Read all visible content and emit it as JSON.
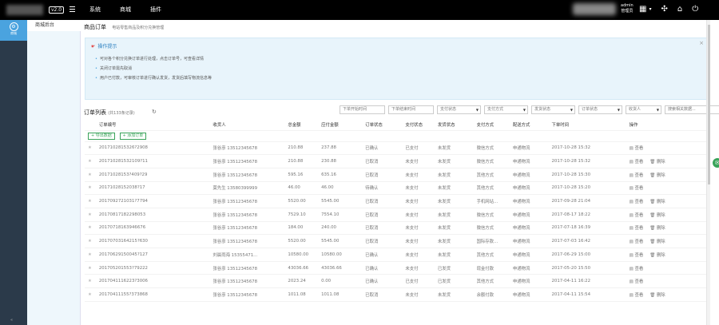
{
  "header": {
    "version": "v2.0",
    "nav": [
      "系统",
      "商城",
      "插件"
    ],
    "admin_name": "admin",
    "admin_role": "管理员",
    "icons": [
      "apps-icon",
      "caret-down-icon",
      "network-icon",
      "home-icon",
      "power-icon"
    ]
  },
  "sidebar": {
    "active_label": "商城",
    "footer": "«"
  },
  "subnav": {
    "active_item": "商城后台"
  },
  "page": {
    "title": "商品订单",
    "subtitle": "电站零售商品及积分兑换管理",
    "tip_title": "操作提示",
    "tip_close": "×",
    "tips": [
      "可对各个积分兑换订单进行处理，点击订单号，可查看详情",
      "关闭订单需先取消",
      "用户已付款，可审核订单进行确认发货，发货后填写物流信息等"
    ]
  },
  "order_list": {
    "title": "订单列表",
    "count_text": "(共133条记录)",
    "refresh_icon": "refresh-icon",
    "filters": [
      {
        "label": "下单开始时间",
        "type": "input"
      },
      {
        "label": "下单结束时间",
        "type": "input"
      },
      {
        "label": "支付状态",
        "type": "select"
      },
      {
        "label": "支付方式",
        "type": "select"
      },
      {
        "label": "发货状态",
        "type": "select"
      },
      {
        "label": "订单状态",
        "type": "select"
      },
      {
        "label": "收货人",
        "type": "select"
      },
      {
        "label": "搜索相关数据...",
        "type": "input"
      },
      {
        "label": "搜索",
        "type": "button"
      }
    ],
    "export_button": "导出数据",
    "add_button": "添加订单",
    "columns": [
      "订单编号",
      "收货人",
      "总金额",
      "应付金额",
      "订单状态",
      "支付状态",
      "发货状态",
      "支付方式",
      "配送方式",
      "下单时间",
      "操作"
    ],
    "rows": [
      {
        "id": "2017102815326?2908",
        "consignee": "张谷彦 13512345678",
        "total": "210.88",
        "payable": "237.88",
        "order_status": "已确认",
        "pay_status": "已支付",
        "ship_status": "未发货",
        "pay_method": "微信方式",
        "ship_method": "申通物流",
        "time": "2017-10-28 15:32",
        "ops": [
          "查看"
        ]
      },
      {
        "id": "201710281532109?11",
        "consignee": "张谷彦 13512345678",
        "total": "210.88",
        "payable": "230.88",
        "order_status": "已取消",
        "pay_status": "未支付",
        "ship_status": "未发货",
        "pay_method": "微信方式",
        "ship_method": "申通物流",
        "time": "2017-10-28 15:32",
        "ops": [
          "查看",
          "删除"
        ]
      },
      {
        "id": "20171028153?409?29",
        "consignee": "张谷彦 13512345678",
        "total": "595.16",
        "payable": "635.16",
        "order_status": "已取消",
        "pay_status": "未支付",
        "ship_status": "未发货",
        "pay_method": "其他方式",
        "ship_method": "申通物流",
        "time": "2017-10-28 15:30",
        "ops": [
          "查看",
          "删除"
        ]
      },
      {
        "id": "20171028152038?17",
        "consignee": "莫先生 13580399999",
        "total": "46.00",
        "payable": "46.00",
        "order_status": "待确认",
        "pay_status": "未支付",
        "ship_status": "未发货",
        "pay_method": "其他方式",
        "ship_method": "申通物流",
        "time": "2017-10-28 15:20",
        "ops": [
          "查看"
        ]
      },
      {
        "id": "2017092721031?7794",
        "consignee": "张谷彦 13512345678",
        "total": "5520.00",
        "payable": "5545.00",
        "order_status": "已取消",
        "pay_status": "未支付",
        "ship_status": "未发货",
        "pay_method": "手机网站...",
        "ship_method": "申通物流",
        "time": "2017-09-28 21:04",
        "ops": [
          "查看",
          "删除"
        ]
      },
      {
        "id": "20170817182298053",
        "consignee": "张谷彦 13512345678",
        "total": "7529.10",
        "payable": "7554.10",
        "order_status": "已取消",
        "pay_status": "未支付",
        "ship_status": "未发货",
        "pay_method": "微信方式",
        "ship_method": "申通物流",
        "time": "2017-08-17 18:22",
        "ops": [
          "查看",
          "删除"
        ]
      },
      {
        "id": "20170718163946676",
        "consignee": "张谷彦 13512345678",
        "total": "184.00",
        "payable": "240.00",
        "order_status": "已取消",
        "pay_status": "未支付",
        "ship_status": "未发货",
        "pay_method": "微信方式",
        "ship_method": "申通物流",
        "time": "2017-07-18 16:39",
        "ops": [
          "查看",
          "删除"
        ]
      },
      {
        "id": "20170703164215?630",
        "consignee": "张谷彦 13512345678",
        "total": "5520.00",
        "payable": "5545.00",
        "order_status": "已取消",
        "pay_status": "未支付",
        "ship_status": "未发货",
        "pay_method": "国际存款...",
        "ship_method": "申通物流",
        "time": "2017-07-03 16:42",
        "ops": [
          "查看",
          "删除"
        ]
      },
      {
        "id": "20170629150045?127",
        "consignee": "刘晨雨海 15355471...",
        "total": "10580.00",
        "payable": "10580.00",
        "order_status": "已确认",
        "pay_status": "未支付",
        "ship_status": "未发货",
        "pay_method": "其他方式",
        "ship_method": "申通物流",
        "time": "2017-06-29 15:00",
        "ops": [
          "查看",
          "删除"
        ]
      },
      {
        "id": "201705201553?79222",
        "consignee": "张谷彦 13512345678",
        "total": "43036.66",
        "payable": "43036.66",
        "order_status": "已确认",
        "pay_status": "未支付",
        "ship_status": "已发货",
        "pay_method": "现金付款",
        "ship_method": "申通物流",
        "time": "2017-05-20 15:50",
        "ops": [
          "查看"
        ]
      },
      {
        "id": "2017041116223?3006",
        "consignee": "张谷彦 13512345678",
        "total": "2023.24",
        "payable": "0.00",
        "order_status": "已确认",
        "pay_status": "已支付",
        "ship_status": "已发货",
        "pay_method": "其他方式",
        "ship_method": "申通物流",
        "time": "2017-04-11 16:22",
        "ops": [
          "查看"
        ]
      },
      {
        "id": "20170411155?373868",
        "consignee": "张谷彦 13512345678",
        "total": "1011.08",
        "payable": "1011.08",
        "order_status": "已取消",
        "pay_status": "未支付",
        "ship_status": "未发货",
        "pay_method": "余额付款",
        "ship_method": "申通物流",
        "time": "2017-04-11 15:54",
        "ops": [
          "查看",
          "删除"
        ]
      }
    ]
  },
  "float_icon": "chat-icon"
}
